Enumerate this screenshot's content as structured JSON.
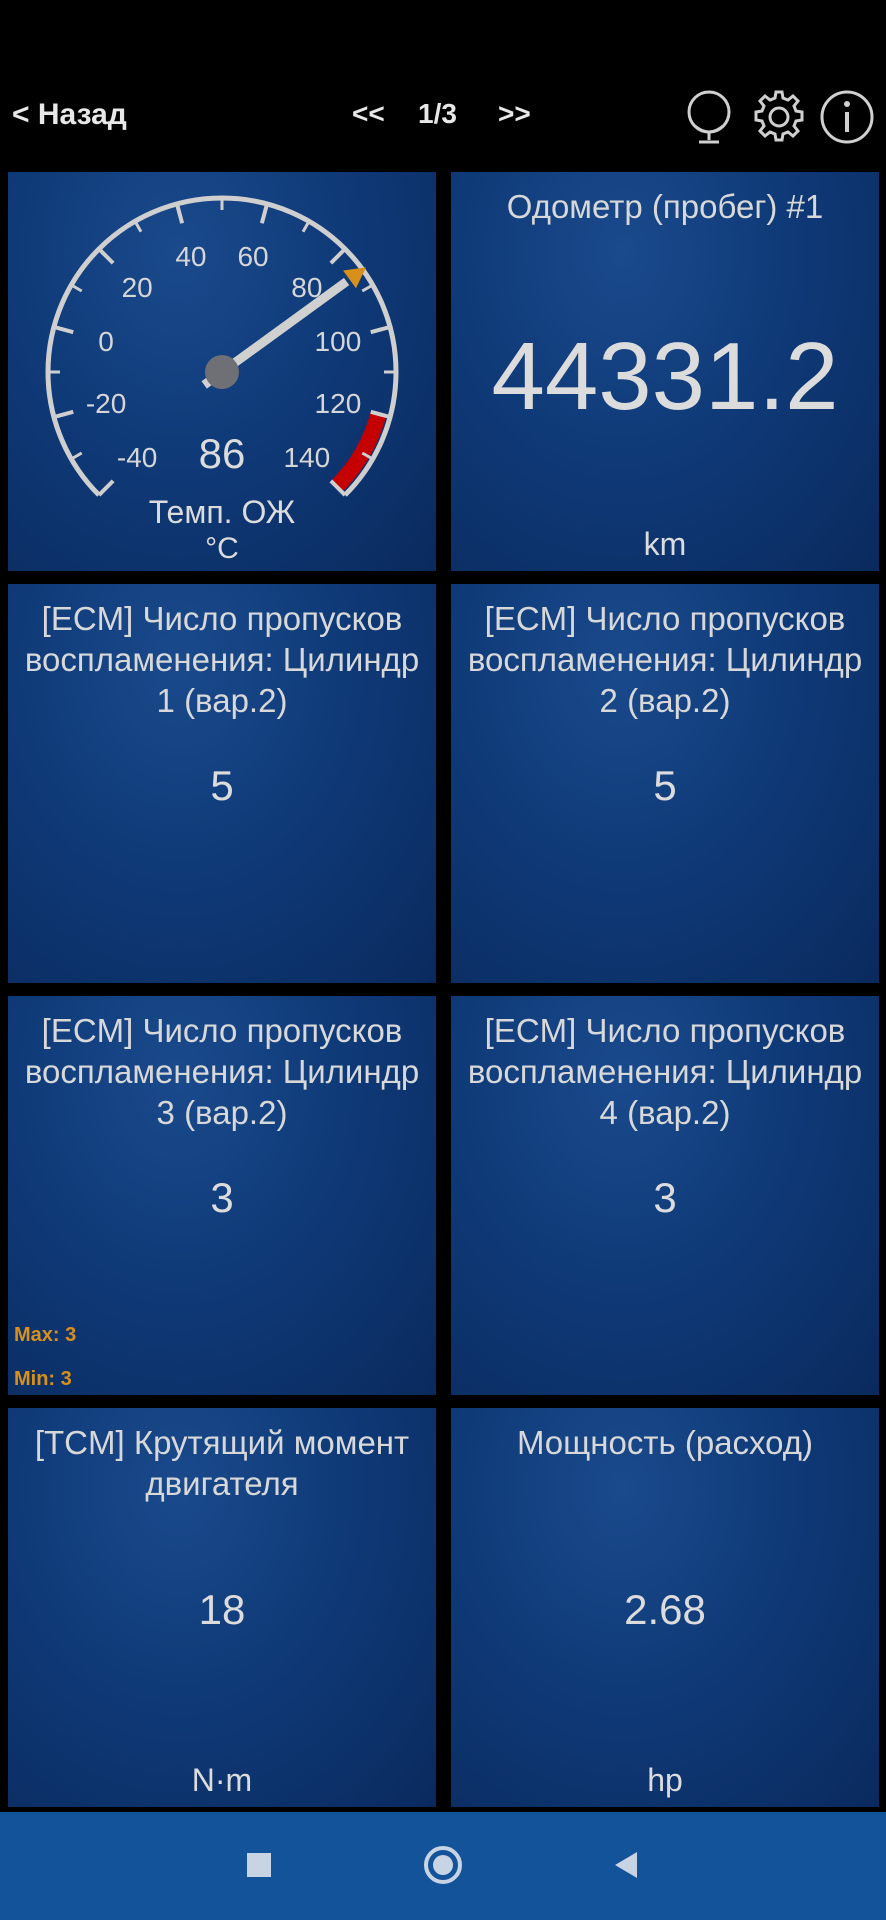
{
  "topbar": {
    "back_label": "< Назад",
    "prev_label": "<<",
    "page": "1/3",
    "next_label": ">>"
  },
  "gauge": {
    "ticks": [
      "-40",
      "-20",
      "0",
      "20",
      "40",
      "60",
      "80",
      "100",
      "120",
      "140"
    ],
    "value": "86",
    "label": "Темп. ОЖ",
    "unit": "°C",
    "min": -40,
    "max": 140,
    "current": 86,
    "warning_min": 120,
    "needle_color": "#d0d0d0",
    "warning_color": "#c40000",
    "marker_color": "#d8901a"
  },
  "tiles": [
    {
      "title": "Одометр (пробег) #1",
      "value": "44331.2",
      "unit": "km"
    },
    {
      "title": "[ECM] Число пропусков воспламенения: Цилиндр 1 (вар.2)",
      "value": "5"
    },
    {
      "title": "[ECM] Число пропусков воспламенения: Цилиндр 2 (вар.2)",
      "value": "5"
    },
    {
      "title": "[ECM] Число пропусков воспламенения: Цилиндр 3 (вар.2)",
      "value": "3",
      "max": "Max: 3",
      "min": "Min: 3"
    },
    {
      "title": "[ECM] Число пропусков воспламенения: Цилиндр 4 (вар.2)",
      "value": "3"
    },
    {
      "title": "[TCM] Крутящий момент двигателя",
      "value": "18",
      "unit": "N·m"
    },
    {
      "title": "Мощность (расход)",
      "value": "2.68",
      "unit": "hp"
    }
  ],
  "icons": {
    "globe": "globe-icon",
    "settings": "gear-icon",
    "info": "info-icon",
    "recents": "square-icon",
    "home": "circle-icon",
    "back": "triangle-back-icon"
  },
  "colors": {
    "accent": "#d8901a",
    "nav_bar": "#13539a"
  }
}
